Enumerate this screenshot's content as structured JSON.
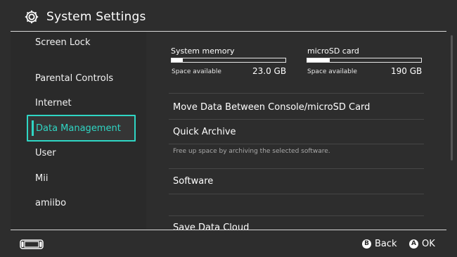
{
  "header": {
    "title": "System Settings",
    "icon": "gear-icon"
  },
  "sidebar": {
    "items": [
      {
        "label": "Screen Lock"
      },
      {
        "label": "Parental Controls"
      },
      {
        "label": "Internet"
      },
      {
        "label": "Data Management",
        "selected": true
      },
      {
        "label": "User"
      },
      {
        "label": "Mii"
      },
      {
        "label": "amiibo"
      }
    ]
  },
  "storage": {
    "system": {
      "title": "System memory",
      "available_label": "Space available",
      "value": "23.0 GB",
      "used_fraction": 0.1
    },
    "sd": {
      "title": "microSD card",
      "available_label": "Space available",
      "value": "190 GB",
      "used_fraction": 0.2
    }
  },
  "options": [
    {
      "label": "Move Data Between Console/microSD Card"
    },
    {
      "label": "Quick Archive",
      "description": "Free up space by archiving the selected software."
    },
    {
      "label": "Software"
    },
    {
      "label": "Save Data Cloud"
    }
  ],
  "footer": {
    "back": {
      "button": "B",
      "label": "Back"
    },
    "ok": {
      "button": "A",
      "label": "OK"
    }
  },
  "colors": {
    "accent": "#2fd6c4",
    "background": "#2d2d2d",
    "text": "#ffffff"
  }
}
